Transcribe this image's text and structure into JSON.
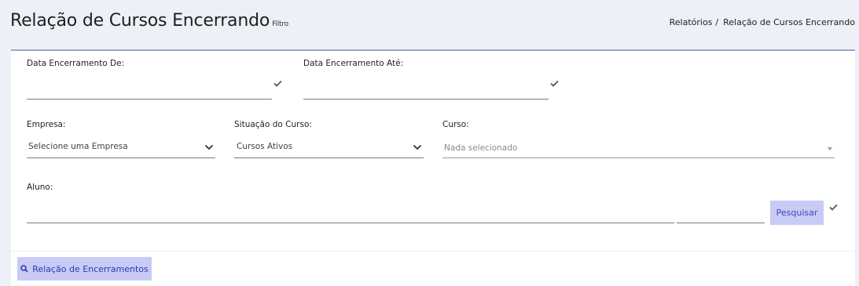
{
  "header": {
    "title": "Relação de Cursos Encerrando",
    "subtitle": "Filtro"
  },
  "breadcrumb": {
    "items": [
      "Relatórios",
      "Relação de Cursos Encerrando"
    ],
    "separator": "/"
  },
  "form": {
    "data_de_label": "Data Encerramento De:",
    "data_ate_label": "Data Encerramento Até:",
    "empresa_label": "Empresa:",
    "empresa_value": "Selecione uma Empresa",
    "situacao_label": "Situação do Curso:",
    "situacao_value": "Cursos Ativos",
    "curso_label": "Curso:",
    "curso_placeholder": "Nada selecionado",
    "aluno_label": "Aluno:",
    "pesquisar_label": "Pesquisar"
  },
  "footer": {
    "report_button_label": "Relação de Encerramentos"
  },
  "colors": {
    "page_bg": "#eef0f8",
    "card_border": "#9aa6cc",
    "button_bg": "#c7cbf6",
    "button_text": "#2e3aa8"
  }
}
